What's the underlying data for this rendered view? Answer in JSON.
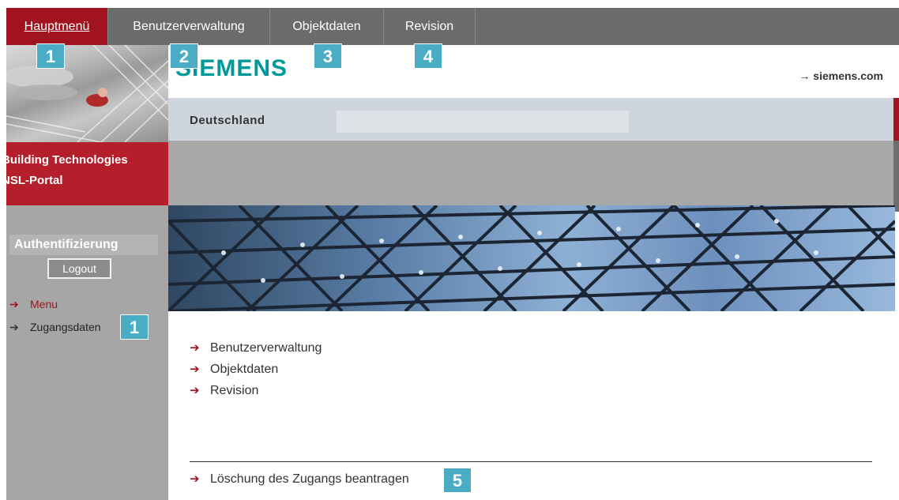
{
  "topnav": {
    "items": [
      {
        "label": "Hauptmenü",
        "active": true
      },
      {
        "label": "Benutzerverwaltung"
      },
      {
        "label": "Objektdaten"
      },
      {
        "label": "Revision"
      }
    ]
  },
  "sidebar": {
    "brand_line1": "Building Technologies",
    "brand_line2": "NSL-Portal",
    "auth_title": "Authentifizierung",
    "logout_label": "Logout",
    "links": [
      {
        "label": "Menu"
      },
      {
        "label": "Zugangsdaten"
      }
    ]
  },
  "header": {
    "logo": "SIEMENS",
    "site_link": "→ siemens.com",
    "country": "Deutschland"
  },
  "content": {
    "links": [
      {
        "label": "Benutzerverwaltung"
      },
      {
        "label": "Objektdaten"
      },
      {
        "label": "Revision"
      }
    ],
    "delete_link": "Löschung des Zugangs beantragen"
  },
  "annotations": {
    "badge_1": "1",
    "badge_2": "2",
    "badge_3": "3",
    "badge_4": "4",
    "badge_side_1": "1",
    "badge_5": "5"
  },
  "colors": {
    "accent_red": "#a0131f",
    "siemens_teal": "#009999",
    "nav_grey": "#6b6b6b",
    "badge_blue": "#4bacc6"
  },
  "icons": {
    "link_arrow": "arrow-right-icon"
  }
}
